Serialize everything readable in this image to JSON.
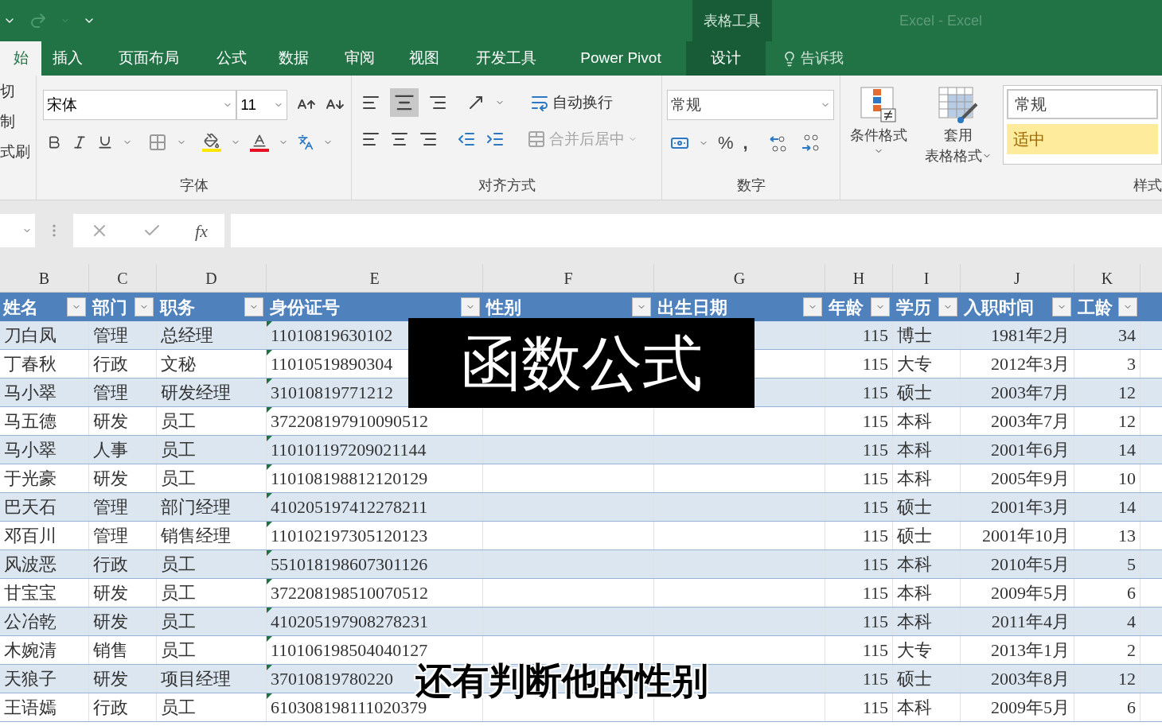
{
  "title_bar": {
    "context_group": "表格工具",
    "title": "Excel - Excel"
  },
  "ribbon_tabs": [
    {
      "label": "始",
      "selected": true,
      "contextual": false
    },
    {
      "label": "插入",
      "selected": false,
      "contextual": false
    },
    {
      "label": "页面布局",
      "selected": false,
      "contextual": false
    },
    {
      "label": "公式",
      "selected": false,
      "contextual": false
    },
    {
      "label": "数据",
      "selected": false,
      "contextual": false
    },
    {
      "label": "审阅",
      "selected": false,
      "contextual": false
    },
    {
      "label": "视图",
      "selected": false,
      "contextual": false
    },
    {
      "label": "开发工具",
      "selected": false,
      "contextual": false
    },
    {
      "label": "Power Pivot",
      "selected": false,
      "contextual": false
    },
    {
      "label": "设计",
      "selected": false,
      "contextual": true
    }
  ],
  "tell_me": "告诉我",
  "clipboard": {
    "items": [
      "切",
      "制",
      "式刷"
    ]
  },
  "font_group": {
    "font_name": "宋体",
    "font_size": "11",
    "label": "字体"
  },
  "alignment_group": {
    "wrap_text": "自动换行",
    "merge_center": "合并后居中",
    "merge_disabled": true,
    "label": "对齐方式"
  },
  "number_group": {
    "format": "常规",
    "percent": "%",
    "comma": ",",
    "label": "数字"
  },
  "styles_group": {
    "conditional_format": "条件格式",
    "table_format": [
      "套用",
      "表格格式"
    ],
    "cells": [
      {
        "label": "常规",
        "color": "#ffffff"
      },
      {
        "label": "适中",
        "color": "#ffeb9c"
      }
    ],
    "label": "样式"
  },
  "formula_bar": {
    "fx": "fx"
  },
  "sheet": {
    "columns": [
      "B",
      "C",
      "D",
      "E",
      "F",
      "G",
      "H",
      "I",
      "J",
      "K"
    ],
    "headers": [
      "姓名",
      "部门",
      "职务",
      "身份证号",
      "性别",
      "出生日期",
      "年龄",
      "学历",
      "入职时间",
      "工龄"
    ],
    "rows": [
      {
        "name": "刀白凤",
        "dept": "管理",
        "position": "总经理",
        "id": "11010819630102",
        "age": "115",
        "edu": "博士",
        "joined": "1981年2月",
        "years": "34"
      },
      {
        "name": "丁春秋",
        "dept": "行政",
        "position": "文秘",
        "id": "11010519890304",
        "age": "115",
        "edu": "大专",
        "joined": "2012年3月",
        "years": "3"
      },
      {
        "name": "马小翠",
        "dept": "管理",
        "position": "研发经理",
        "id": "31010819771212",
        "age": "115",
        "edu": "硕士",
        "joined": "2003年7月",
        "years": "12"
      },
      {
        "name": "马五德",
        "dept": "研发",
        "position": "员工",
        "id": "372208197910090512",
        "age": "115",
        "edu": "本科",
        "joined": "2003年7月",
        "years": "12"
      },
      {
        "name": "马小翠",
        "dept": "人事",
        "position": "员工",
        "id": "110101197209021144",
        "age": "115",
        "edu": "本科",
        "joined": "2001年6月",
        "years": "14"
      },
      {
        "name": "于光豪",
        "dept": "研发",
        "position": "员工",
        "id": "110108198812120129",
        "age": "115",
        "edu": "本科",
        "joined": "2005年9月",
        "years": "10"
      },
      {
        "name": "巴天石",
        "dept": "管理",
        "position": "部门经理",
        "id": "410205197412278211",
        "age": "115",
        "edu": "硕士",
        "joined": "2001年3月",
        "years": "14"
      },
      {
        "name": "邓百川",
        "dept": "管理",
        "position": "销售经理",
        "id": "110102197305120123",
        "age": "115",
        "edu": "硕士",
        "joined": "2001年10月",
        "years": "13"
      },
      {
        "name": "风波恶",
        "dept": "行政",
        "position": "员工",
        "id": "551018198607301126",
        "age": "115",
        "edu": "本科",
        "joined": "2010年5月",
        "years": "5"
      },
      {
        "name": "甘宝宝",
        "dept": "研发",
        "position": "员工",
        "id": "372208198510070512",
        "age": "115",
        "edu": "本科",
        "joined": "2009年5月",
        "years": "6"
      },
      {
        "name": "公冶乾",
        "dept": "研发",
        "position": "员工",
        "id": "410205197908278231",
        "age": "115",
        "edu": "本科",
        "joined": "2011年4月",
        "years": "4"
      },
      {
        "name": "木婉清",
        "dept": "销售",
        "position": "员工",
        "id": "110106198504040127",
        "age": "115",
        "edu": "大专",
        "joined": "2013年1月",
        "years": "2"
      },
      {
        "name": "天狼子",
        "dept": "研发",
        "position": "项目经理",
        "id": "37010819780220",
        "age": "115",
        "edu": "硕士",
        "joined": "2003年8月",
        "years": "12"
      },
      {
        "name": "王语嫣",
        "dept": "行政",
        "position": "员工",
        "id": "610308198111020379",
        "age": "115",
        "edu": "本科",
        "joined": "2009年5月",
        "years": "6"
      }
    ]
  },
  "overlays": [
    {
      "kind": "caption",
      "text": "函数公式"
    },
    {
      "kind": "subtitle",
      "text": "还有判断他的性别"
    }
  ]
}
